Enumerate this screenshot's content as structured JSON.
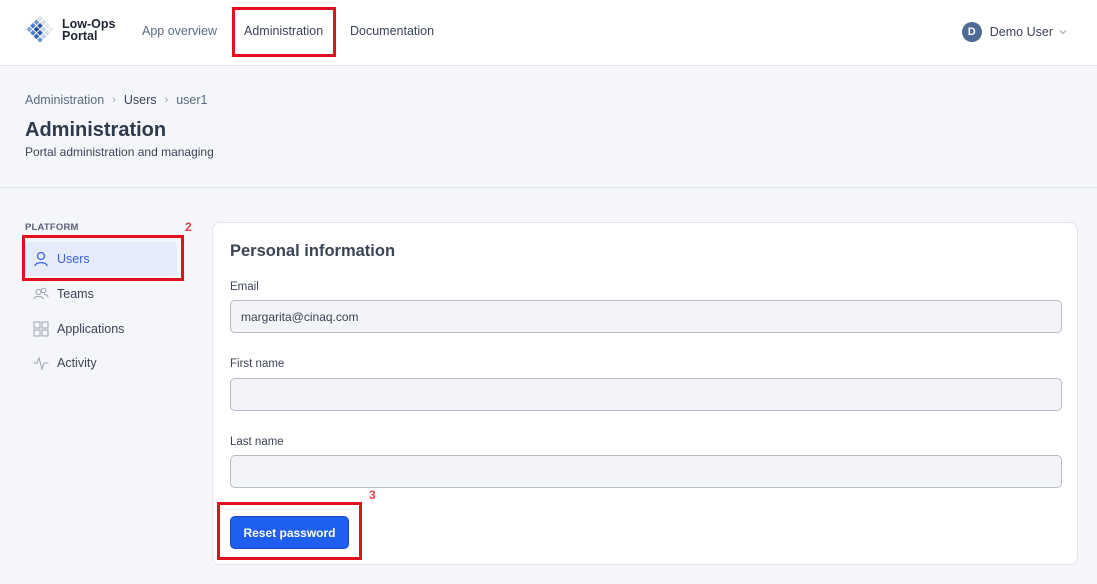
{
  "app": {
    "logo_line1": "Low-Ops",
    "logo_line2": "Portal"
  },
  "nav": {
    "items": [
      {
        "label": "App overview"
      },
      {
        "label": "Administration"
      },
      {
        "label": "Documentation"
      }
    ]
  },
  "user_menu": {
    "initial": "D",
    "name": "Demo User"
  },
  "breadcrumb": [
    "Administration",
    "Users",
    "user1"
  ],
  "header": {
    "title": "Administration",
    "subtitle": "Portal administration and managing"
  },
  "sidebar": {
    "section": "PLATFORM",
    "items": [
      {
        "label": "Users",
        "icon": "user-icon",
        "active": true
      },
      {
        "label": "Teams",
        "icon": "team-icon"
      },
      {
        "label": "Applications",
        "icon": "grid-icon"
      },
      {
        "label": "Activity",
        "icon": "activity-icon"
      }
    ]
  },
  "form": {
    "title": "Personal information",
    "fields": [
      {
        "label": "Email",
        "value": "margarita@cinaq.com"
      },
      {
        "label": "First name",
        "value": ""
      },
      {
        "label": "Last name",
        "value": ""
      }
    ],
    "reset_button": "Reset password"
  },
  "annotations": {
    "sidebar_number": "2",
    "button_number": "3",
    "color": "#e0111f"
  },
  "colors": {
    "primary": "#1f5ff0",
    "active_bg": "#e6ebfa",
    "active_text": "#3a63d8"
  }
}
